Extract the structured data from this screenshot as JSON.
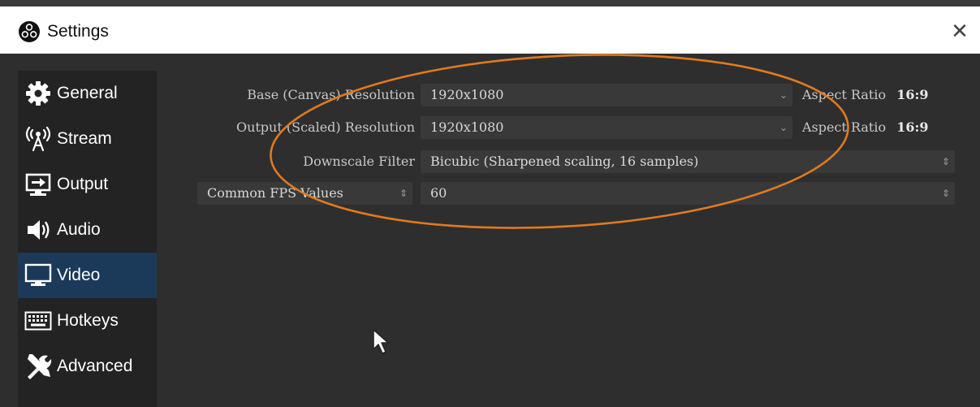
{
  "window": {
    "title": "Settings",
    "close_glyph": "✕"
  },
  "sidebar": {
    "items": [
      {
        "label": "General",
        "icon": "gear-icon"
      },
      {
        "label": "Stream",
        "icon": "broadcast-icon"
      },
      {
        "label": "Output",
        "icon": "output-icon"
      },
      {
        "label": "Audio",
        "icon": "speaker-icon"
      },
      {
        "label": "Video",
        "icon": "monitor-icon",
        "selected": true
      },
      {
        "label": "Hotkeys",
        "icon": "keyboard-icon"
      },
      {
        "label": "Advanced",
        "icon": "tools-icon"
      }
    ]
  },
  "video": {
    "base_resolution": {
      "label": "Base (Canvas) Resolution",
      "value": "1920x1080",
      "aspect_label": "Aspect Ratio",
      "aspect_value": "16:9"
    },
    "output_resolution": {
      "label": "Output (Scaled) Resolution",
      "value": "1920x1080",
      "aspect_label": "Aspect Ratio",
      "aspect_value": "16:9"
    },
    "downscale_filter": {
      "label": "Downscale Filter",
      "value": "Bicubic (Sharpened scaling, 16 samples)"
    },
    "fps": {
      "mode": "Common FPS Values",
      "value": "60"
    }
  },
  "colors": {
    "selected_nav": "#1b3a5a",
    "highlight_ellipse": "#e07a1f",
    "panel_bg": "#2e2e2e",
    "sidebar_bg": "#232323"
  }
}
